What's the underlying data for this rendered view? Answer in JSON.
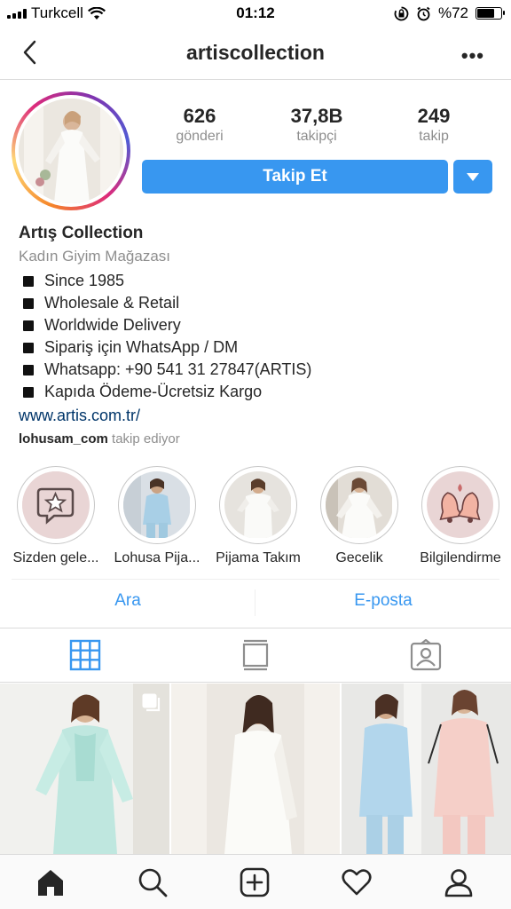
{
  "status_bar": {
    "carrier": "Turkcell",
    "time": "01:12",
    "battery_text": "%72",
    "battery_level": 0.72
  },
  "nav": {
    "title": "artiscollection",
    "more_label": "•••"
  },
  "profile": {
    "stats": [
      {
        "value": "626",
        "label": "gönderi"
      },
      {
        "value": "37,8B",
        "label": "takipçi"
      },
      {
        "value": "249",
        "label": "takip"
      }
    ],
    "follow_label": "Takip Et"
  },
  "bio": {
    "name": "Artış Collection",
    "category": "Kadın Giyim Mağazası",
    "lines": [
      "Since 1985",
      "Wholesale & Retail",
      "Worldwide Delivery",
      "Sipariş için WhatsApp / DM",
      "Whatsapp: +90 541 31 27847(ARTIS)",
      "Kapıda Ödeme-Ücretsiz Kargo"
    ],
    "link": "www.artis.com.tr/",
    "followed_by_user": "lohusam_com",
    "followed_by_text": "takip ediyor"
  },
  "highlights": [
    {
      "label": "Sizden gele...",
      "icon": "star-chat-icon"
    },
    {
      "label": "Lohusa Pija...",
      "icon": "photo"
    },
    {
      "label": "Pijama Takım",
      "icon": "photo"
    },
    {
      "label": "Gecelik",
      "icon": "photo"
    },
    {
      "label": "Bilgilendirme",
      "icon": "bells-icon"
    }
  ],
  "actions": {
    "call": "Ara",
    "email": "E-posta"
  },
  "colors": {
    "accent": "#3897f0",
    "text": "#262626",
    "muted": "#8e8e8e",
    "link": "#003569"
  }
}
